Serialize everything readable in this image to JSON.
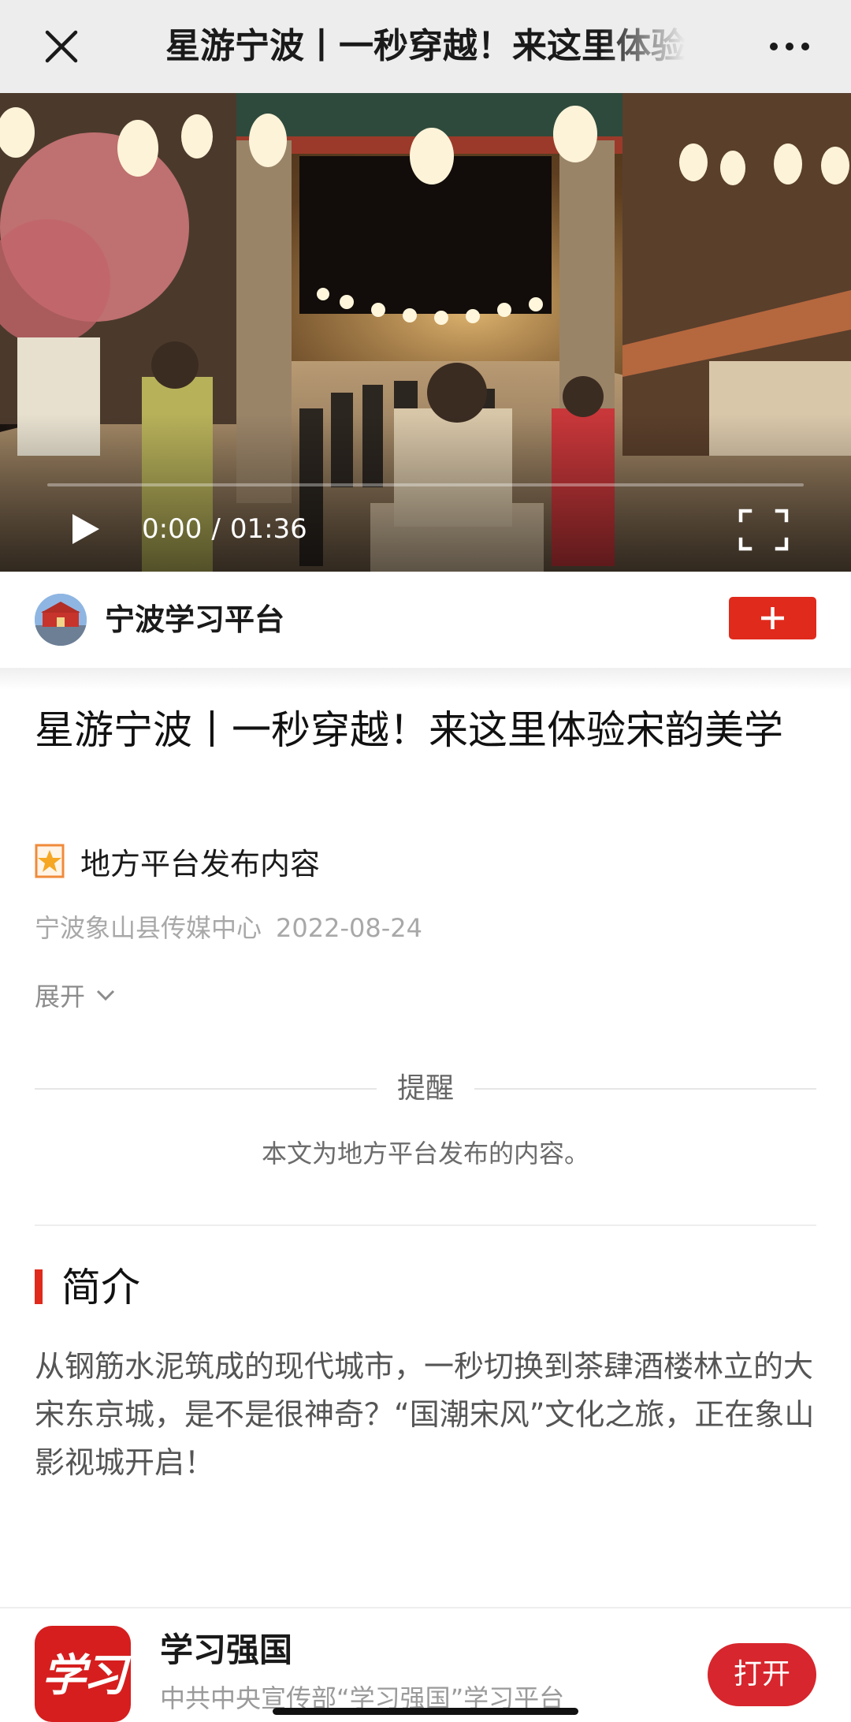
{
  "navbar": {
    "title": "星游宁波丨一秒穿越！来这里体验宋韵美学",
    "close_icon": "close-icon",
    "more_icon": "more-dots-icon"
  },
  "video": {
    "current_time": "0:00",
    "separator": "/",
    "duration": "01:36",
    "progress": 0,
    "play_icon": "play-icon",
    "fullscreen_icon": "fullscreen-icon"
  },
  "publisher": {
    "name": "宁波学习平台",
    "follow_icon": "plus-icon"
  },
  "article": {
    "title": "星游宁波丨一秒穿越！来这里体验宋韵美学",
    "tag_label": "地方平台发布内容",
    "tag_icon": "star-badge-icon",
    "source": "宁波象山县传媒中心",
    "date": "2022-08-24",
    "expand_label": "展开",
    "expand_icon": "chevron-down-icon"
  },
  "reminder": {
    "title": "提醒",
    "text": "本文为地方平台发布的内容。"
  },
  "intro": {
    "title": "简介",
    "text": "从钢筋水泥筑成的现代城市，一秒切换到茶肆酒楼林立的大宋东京城，是不是很神奇？“国潮宋风”文化之旅，正在象山影视城开启！"
  },
  "app_banner": {
    "logo_text": "学习",
    "name": "学习强国",
    "description": "中共中央宣传部“学习强国”学习平台",
    "open_label": "打开"
  },
  "colors": {
    "accent_red": "#e02a1c",
    "open_button": "#d7262d",
    "navbar_bg": "#ededed"
  }
}
